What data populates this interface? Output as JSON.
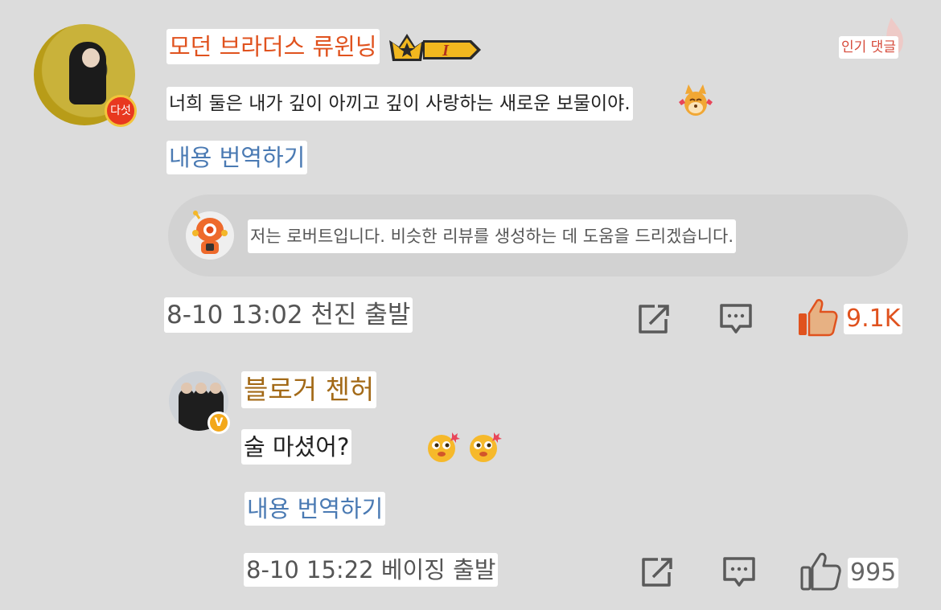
{
  "main_comment": {
    "username": "모던 브라더스 류윈닝",
    "level_badge": "다섯",
    "rank_badge": "I",
    "popular_tag": "인기 댓글",
    "text": "너희 둘은 내가 깊이 아끼고 깊이 사랑하는 새로운 보물이야.",
    "emoji": "dog-sticker-icon",
    "translate_label": "내용 번역하기",
    "robot_note": "저는 로버트입니다. 비슷한 리뷰를 생성하는 데 도움을 드리겠습니다.",
    "meta": "8-10 13:02 천진 출발",
    "like_count": "9.1K",
    "liked": true
  },
  "reply": {
    "username": "블로거 첸허",
    "verified_badge": "V",
    "text": "술 마셨어?",
    "emojis": [
      "smirk-face-icon",
      "smirk-face-icon"
    ],
    "translate_label": "내용 번역하기",
    "meta": "8-10 15:22 베이징 출발",
    "like_count": "995",
    "liked": false
  },
  "colors": {
    "background": "#dcdcdc",
    "username_main": "#e0521e",
    "username_reply": "#a36a18",
    "link": "#4a7ab3",
    "like_active": "#e0521e"
  },
  "icons": [
    "share-icon",
    "comment-icon",
    "thumbs-up-icon"
  ]
}
